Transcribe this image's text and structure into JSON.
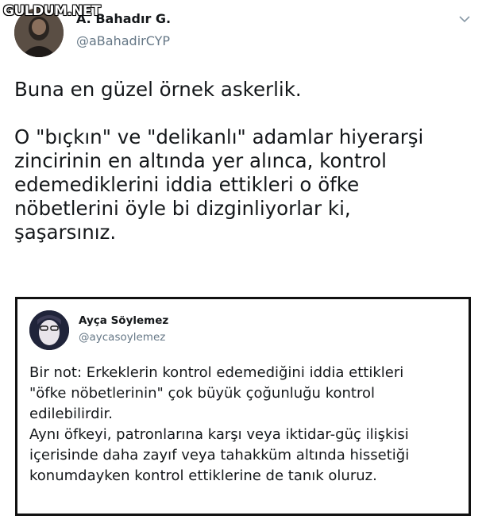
{
  "watermark": "GULDUM.NET",
  "tweet": {
    "author_name": "A. Bahadır G.",
    "author_handle": "@aBahadirCYP",
    "text": "Buna en güzel örnek askerlik.\n\nO \"bıçkın\" ve \"delikanlı\" adamlar hiyerarşi\nzincirinin en altında yer alınca, kontrol\nedemediklerini iddia ettikleri o öfke\nnöbetlerini öyle bi dizginliyorlar ki,\nşaşarsınız."
  },
  "quoted_tweet": {
    "author_name": "Ayça Söylemez",
    "author_handle": "@aycasoylemez",
    "paragraph_1": "Bir not: Erkeklerin kontrol edemediğini iddia ettikleri\n\"öfke nöbetlerinin\" çok büyük çoğunluğu kontrol\nedilebilirdir.",
    "paragraph_2": "Aynı öfkeyi, patronlarına karşı veya iktidar-güç ilişkisi\niçerisinde daha zayıf veya tahakküm altında hissetiği\nkonumdayken kontrol ettiklerine de tanık oluruz."
  },
  "icons": {
    "more": "chevron-down-icon"
  },
  "colors": {
    "text": "#14171a",
    "secondary": "#657786",
    "quote_border": "#111111"
  }
}
